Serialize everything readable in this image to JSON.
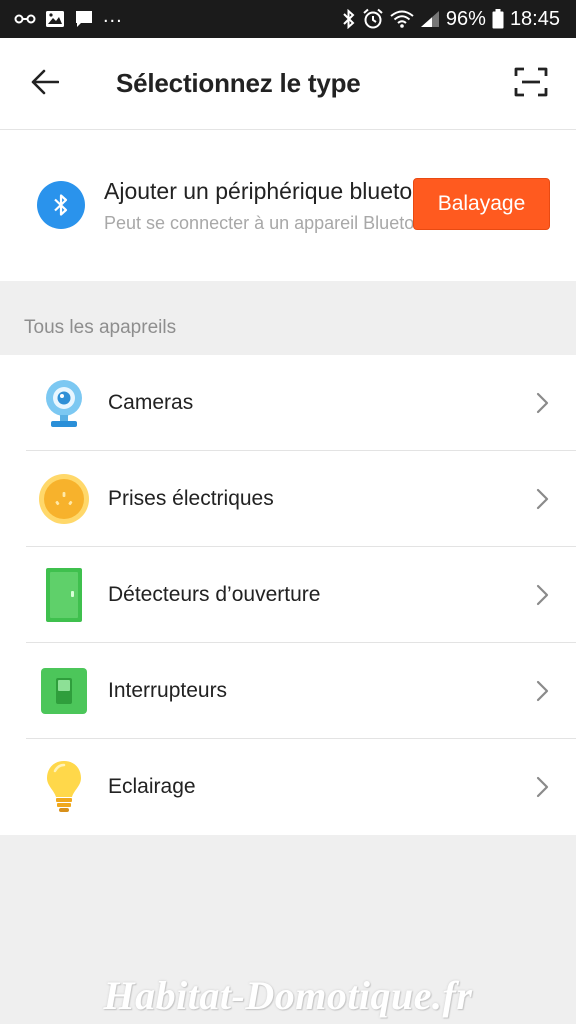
{
  "status_bar": {
    "overflow": "...",
    "battery_percent": "96%",
    "time": "18:45"
  },
  "header": {
    "title": "Sélectionnez le type"
  },
  "bluetooth_card": {
    "title": "Ajouter un périphérique bluetooth",
    "subtitle": "Peut se connecter à un appareil Bluetooth",
    "scan_button_label": "Balayage"
  },
  "section": {
    "label": "Tous les apapreils"
  },
  "device_types": [
    {
      "label": "Cameras",
      "icon": "camera-icon"
    },
    {
      "label": "Prises électriques",
      "icon": "plug-icon"
    },
    {
      "label": "Détecteurs d’ouverture",
      "icon": "door-sensor-icon"
    },
    {
      "label": "Interrupteurs",
      "icon": "switch-icon"
    },
    {
      "label": "Eclairage",
      "icon": "bulb-icon"
    }
  ],
  "watermark": "Habitat-Domotique.fr",
  "colors": {
    "accent_orange": "#ff5a1f",
    "bluetooth_blue": "#2a93ec",
    "background": "#efefef"
  }
}
